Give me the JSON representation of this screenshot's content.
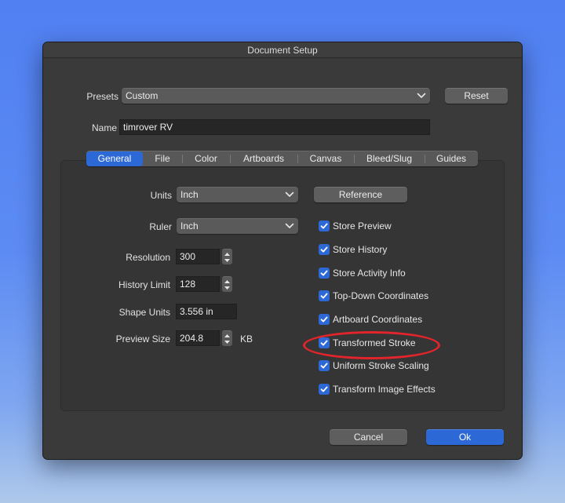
{
  "window": {
    "title": "Document Setup"
  },
  "presets": {
    "label": "Presets",
    "value": "Custom",
    "reset_label": "Reset"
  },
  "name": {
    "label": "Name",
    "value": "timrover RV"
  },
  "tabs": [
    {
      "label": "General",
      "active": true
    },
    {
      "label": "File",
      "active": false
    },
    {
      "label": "Color",
      "active": false
    },
    {
      "label": "Artboards",
      "active": false
    },
    {
      "label": "Canvas",
      "active": false
    },
    {
      "label": "Bleed/Slug",
      "active": false
    },
    {
      "label": "Guides",
      "active": false
    }
  ],
  "general": {
    "units": {
      "label": "Units",
      "value": "Inch"
    },
    "ruler": {
      "label": "Ruler",
      "value": "Inch"
    },
    "resolution": {
      "label": "Resolution",
      "value": "300"
    },
    "history_limit": {
      "label": "History Limit",
      "value": "128"
    },
    "shape_units": {
      "label": "Shape Units",
      "value": "3.556 in"
    },
    "preview_size": {
      "label": "Preview Size",
      "value": "204.8",
      "unit": "KB"
    },
    "reference_label": "Reference",
    "options": [
      {
        "label": "Store Preview",
        "checked": true
      },
      {
        "label": "Store History",
        "checked": true
      },
      {
        "label": "Store Activity Info",
        "checked": true
      },
      {
        "label": "Top-Down Coordinates",
        "checked": true
      },
      {
        "label": "Artboard Coordinates",
        "checked": true
      },
      {
        "label": "Transformed Stroke",
        "checked": true
      },
      {
        "label": "Uniform Stroke Scaling",
        "checked": true
      },
      {
        "label": "Transform Image Effects",
        "checked": true
      }
    ]
  },
  "footer": {
    "cancel_label": "Cancel",
    "ok_label": "Ok"
  },
  "colors": {
    "accent": "#2c69d6",
    "highlight": "#e3242b",
    "dialog_bg": "#3a3a3a"
  }
}
